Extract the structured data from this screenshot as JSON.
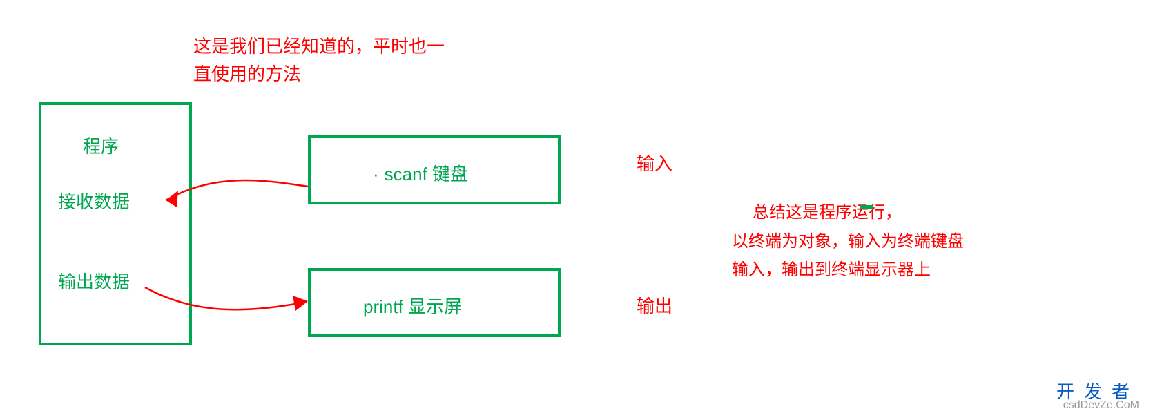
{
  "annotation": {
    "top_line1": "这是我们已经知道的，平时也一",
    "top_line2": "直使用的方法"
  },
  "left_box": {
    "label_program": "程序",
    "label_receive": "接收数据",
    "label_output": "输出数据"
  },
  "scanf_box": {
    "label": "scanf 键盘"
  },
  "printf_box": {
    "label": "printf 显示屏"
  },
  "labels": {
    "input": "输入",
    "output": "输出"
  },
  "summary": {
    "line1": "总结这是程序运行，",
    "line2": "以终端为对象，输入为终端键盘输入，输出到终端显示器上"
  },
  "watermark": {
    "cn": "开发者",
    "en": "csdDevZe.CoM"
  },
  "colors": {
    "green": "#00a650",
    "red": "#ff0000",
    "blue": "#0a5bc4"
  }
}
